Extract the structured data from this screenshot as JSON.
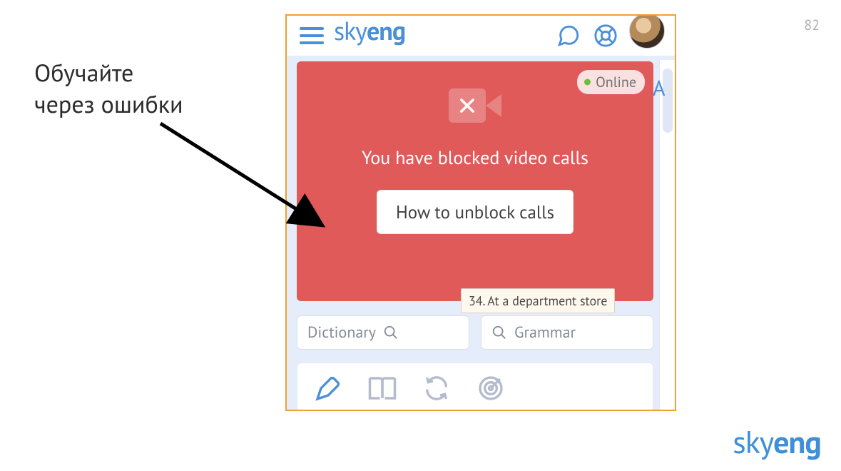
{
  "slide": {
    "number": "82"
  },
  "annotation": {
    "line1": "Обучайте",
    "line2": "через ошибки"
  },
  "brand": {
    "name_light": "sky",
    "name_bold": "eng"
  },
  "app": {
    "logo_light": "sky",
    "logo_bold": "eng",
    "right_col_initial": "A"
  },
  "error_card": {
    "title": "You have blocked video calls",
    "button_label": "How to unblock calls",
    "status": "Online"
  },
  "tooltip": {
    "text": "34. At a department store"
  },
  "search": {
    "dictionary_label": "Dictionary",
    "grammar_label": "Grammar"
  }
}
